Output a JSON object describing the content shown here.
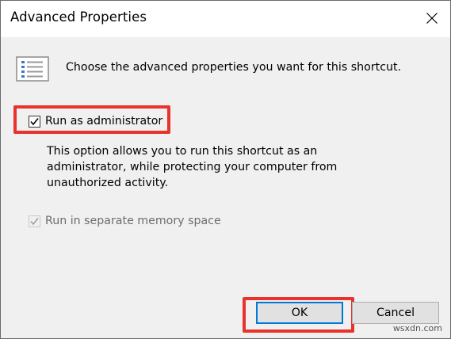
{
  "window": {
    "title": "Advanced Properties"
  },
  "intro": {
    "text": "Choose the advanced properties you want for this shortcut."
  },
  "run_as_admin": {
    "label": "Run as administrator",
    "checked": true
  },
  "description": {
    "line1": "This option allows you to run this shortcut as an",
    "line2": "administrator, while protecting your computer from",
    "line3": "unauthorized activity."
  },
  "separate_memory": {
    "label": "Run in separate memory space",
    "checked": true,
    "disabled": true
  },
  "buttons": {
    "ok": "OK",
    "cancel": "Cancel"
  },
  "watermark": "wsxdn.com",
  "colors": {
    "highlight": "#e8322b",
    "focus_border": "#0078d7",
    "content_bg": "#f0f0f0"
  },
  "icons": {
    "properties": "list-properties-icon",
    "close": "close-icon",
    "check": "checkmark-icon"
  }
}
